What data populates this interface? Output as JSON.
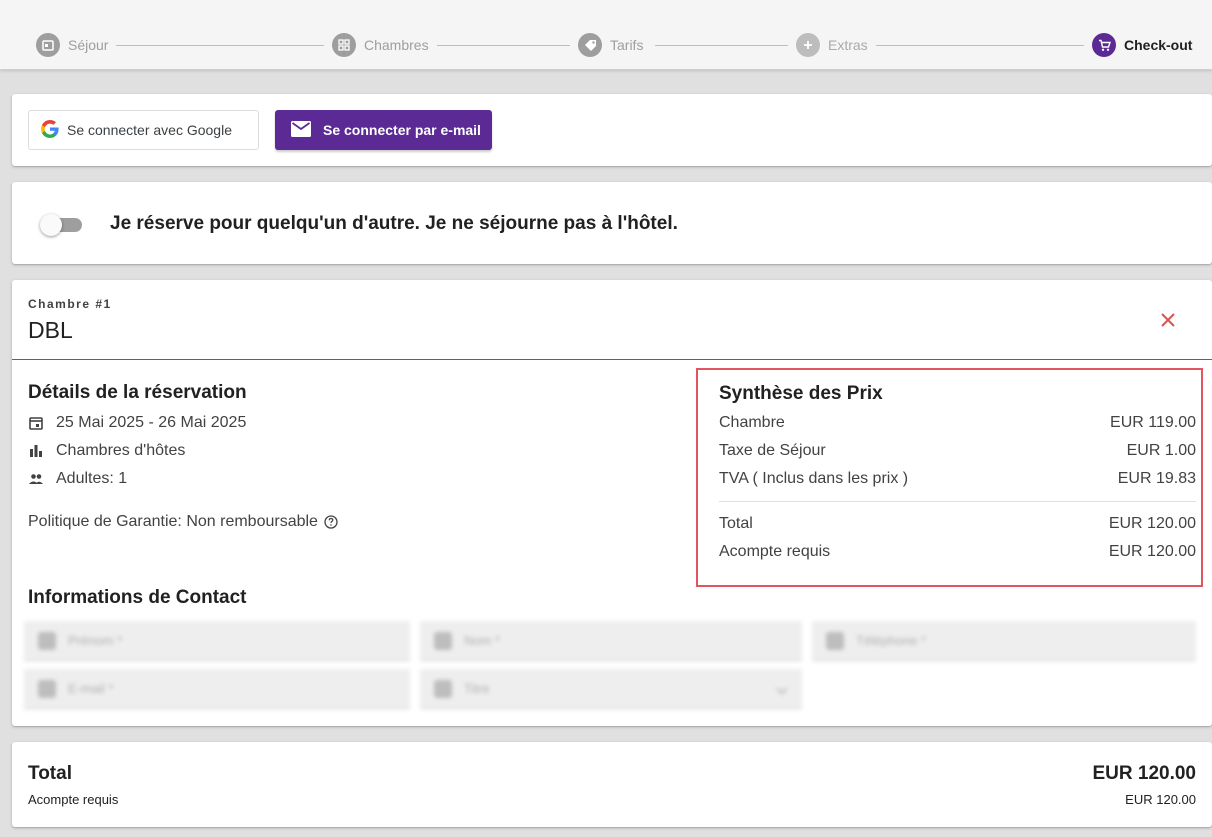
{
  "stepper": {
    "steps": [
      {
        "label": "Séjour",
        "icon": "calendar-icon"
      },
      {
        "label": "Chambres",
        "icon": "grid-icon"
      },
      {
        "label": "Tarifs",
        "icon": "tag-icon"
      },
      {
        "label": "Extras",
        "icon": "plus-icon"
      },
      {
        "label": "Check-out",
        "icon": "cart-icon"
      }
    ],
    "active_index": 4,
    "accent_color": "#5b2a94"
  },
  "login": {
    "google_label": "Se connecter avec Google",
    "email_label": "Se connecter par e-mail"
  },
  "booking_for_other": {
    "label": "Je réserve pour quelqu'un d'autre. Je ne séjourne pas à l'hôtel.",
    "checked": false
  },
  "room": {
    "overline": "Chambre #1",
    "name": "DBL",
    "details": {
      "title": "Détails de la réservation",
      "dates": "25 Mai 2025 - 26 Mai 2025",
      "room_type": "Chambres d'hôtes",
      "adults": "Adultes: 1",
      "policy": "Politique de Garantie: Non remboursable"
    },
    "price_summary": {
      "title": "Synthèse des Prix",
      "rows": [
        {
          "label": "Chambre",
          "value": "EUR 119.00"
        },
        {
          "label": "Taxe de Séjour",
          "value": "EUR 1.00"
        },
        {
          "label": "TVA ( Inclus dans les prix )",
          "value": "EUR 19.83"
        }
      ],
      "total": {
        "label": "Total",
        "value": "EUR 120.00"
      },
      "deposit": {
        "label": "Acompte requis",
        "value": "EUR 120.00"
      }
    },
    "contact": {
      "title": "Informations de Contact",
      "fields": [
        "Prénom *",
        "Nom *",
        "Téléphone *",
        "E-mail *",
        "Titre"
      ]
    }
  },
  "totals": {
    "total_label": "Total",
    "total_value": "EUR 120.00",
    "deposit_label": "Acompte requis",
    "deposit_value": "EUR 120.00"
  }
}
